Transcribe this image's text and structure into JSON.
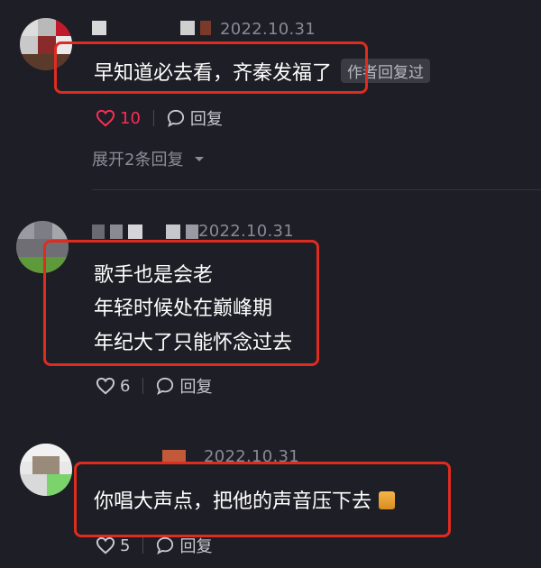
{
  "comments": [
    {
      "date": "2022.10.31",
      "lines": [
        "早知道必去看，齐秦发福了"
      ],
      "author_tag": "作者回复过",
      "like_count": "10",
      "liked": true,
      "reply_label": "回复",
      "expand_label": "展开2条回复"
    },
    {
      "date": "2022.10.31",
      "lines": [
        "歌手也是会老",
        "年轻时候处在巅峰期",
        "年纪大了只能怀念过去"
      ],
      "like_count": "6",
      "liked": false,
      "reply_label": "回复"
    },
    {
      "date": "2022.10.31",
      "lines": [
        "你唱大声点，把他的声音压下去"
      ],
      "like_count": "5",
      "liked": false,
      "reply_label": "回复"
    }
  ],
  "colors": {
    "background": "#1e1e26",
    "highlight_box": "#e02b1f",
    "liked": "#fe2c55"
  },
  "icons": [
    "heart-icon",
    "comment-bubble-icon",
    "chevron-down-icon",
    "emoji-icon"
  ]
}
